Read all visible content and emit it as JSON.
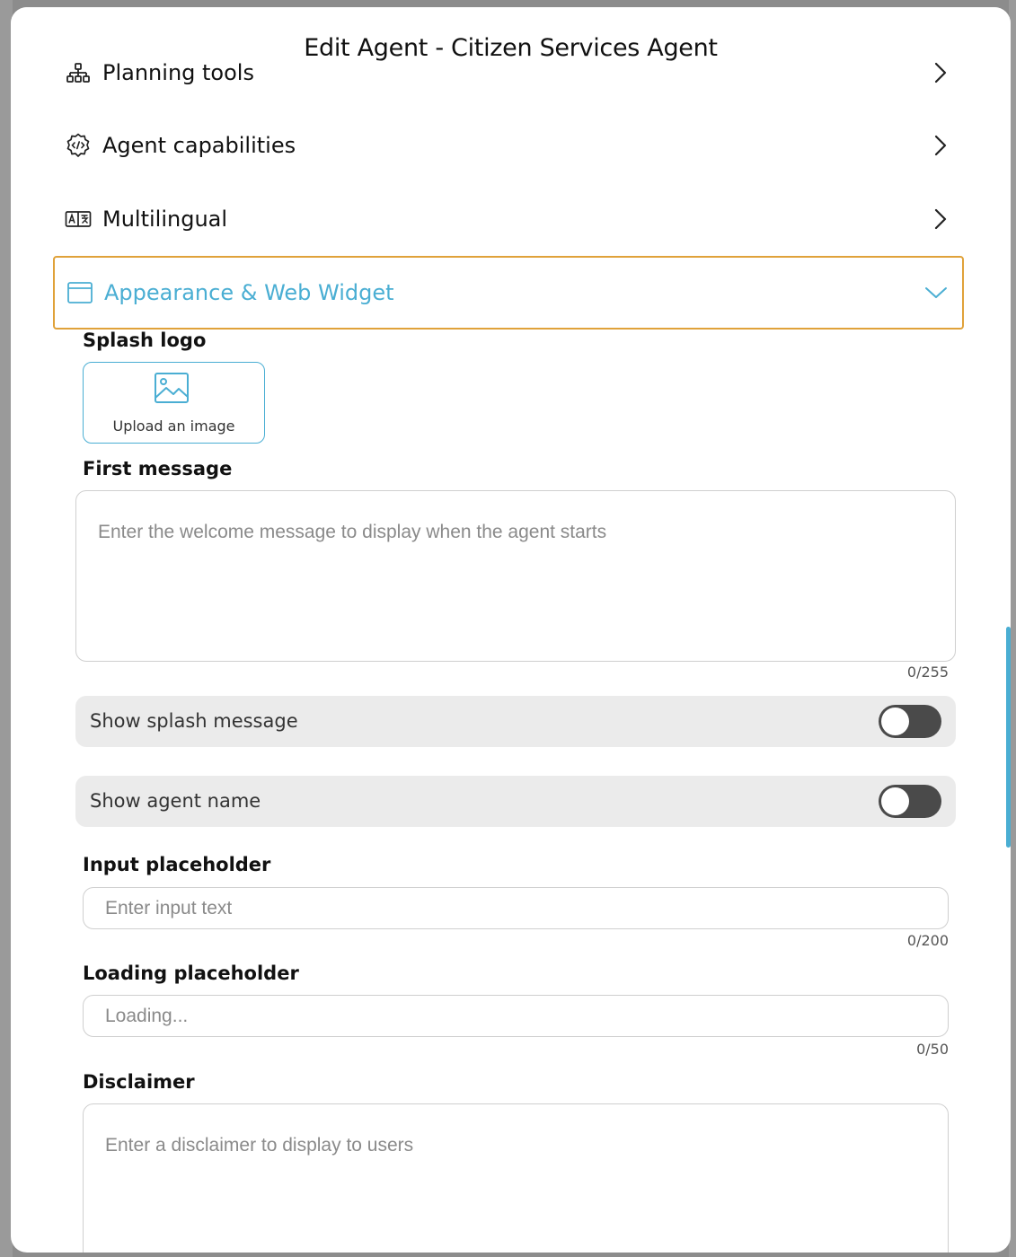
{
  "modal": {
    "title": "Edit Agent - Citizen Services Agent",
    "close_icon": "close-icon",
    "accent_color": "#4aaed3",
    "highlight_color": "#e0a23a"
  },
  "sections": [
    {
      "label": "Planning tools",
      "icon": "hierarchy-icon",
      "expanded": false
    },
    {
      "label": "Agent capabilities",
      "icon": "gear-code-icon",
      "expanded": false
    },
    {
      "label": "Multilingual",
      "icon": "translate-icon",
      "expanded": false
    },
    {
      "label": "Appearance & Web Widget",
      "icon": "window-icon",
      "expanded": true
    }
  ],
  "appearance": {
    "splash_logo": {
      "label": "Splash logo",
      "upload_label": "Upload an image",
      "icon": "image-icon"
    },
    "first_message": {
      "label": "First message",
      "placeholder": "Enter the welcome message to display when the agent starts",
      "value": "",
      "counter": "0/255"
    },
    "show_splash_message": {
      "label": "Show splash message",
      "on": false
    },
    "show_agent_name": {
      "label": "Show agent name",
      "on": false
    },
    "input_placeholder": {
      "label": "Input placeholder",
      "placeholder": "Enter input text",
      "value": "",
      "counter": "0/200"
    },
    "loading_placeholder": {
      "label": "Loading placeholder",
      "placeholder": "Loading...",
      "value": "",
      "counter": "0/50"
    },
    "disclaimer": {
      "label": "Disclaimer",
      "placeholder": "Enter a disclaimer to display to users",
      "value": ""
    }
  }
}
